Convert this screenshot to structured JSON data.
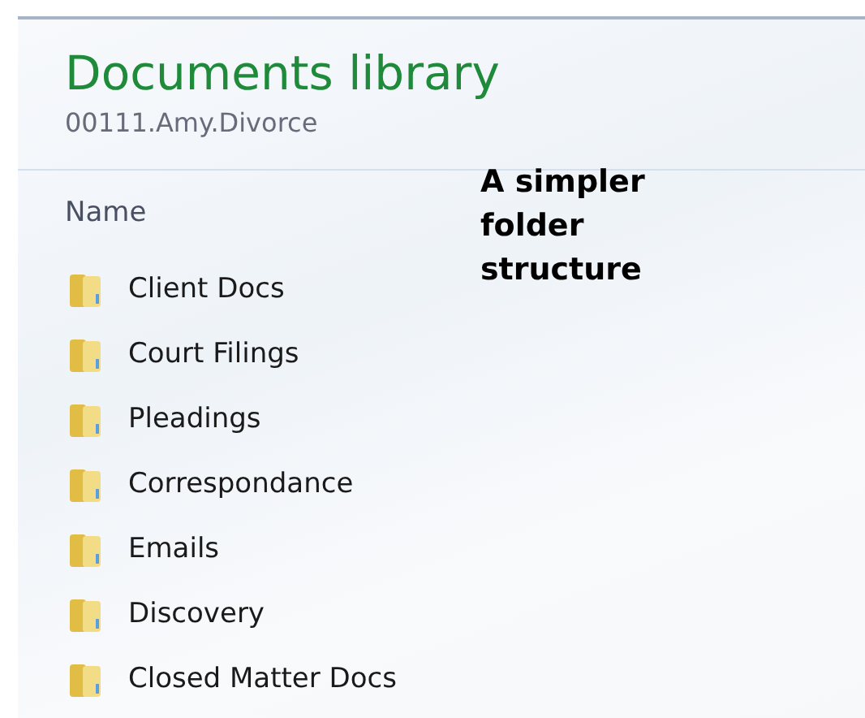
{
  "library": {
    "title": "Documents library",
    "subtitle": "00111.Amy.Divorce"
  },
  "annotation": "A simpler folder structure",
  "column_header": "Name",
  "folders": [
    {
      "name": "Client Docs"
    },
    {
      "name": "Court Filings"
    },
    {
      "name": "Pleadings"
    },
    {
      "name": "Correspondance"
    },
    {
      "name": "Emails"
    },
    {
      "name": "Discovery"
    },
    {
      "name": "Closed Matter Docs"
    }
  ]
}
